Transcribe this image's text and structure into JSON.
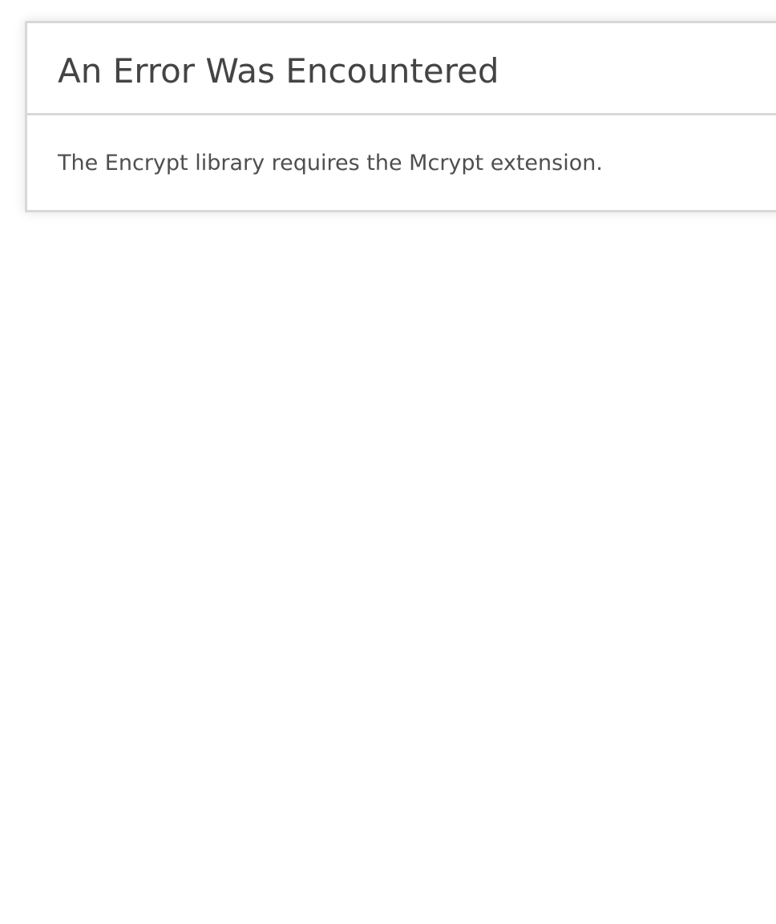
{
  "error": {
    "title": "An Error Was Encountered",
    "message": "The Encrypt library requires the Mcrypt extension."
  },
  "colors": {
    "background": "#ffffff",
    "border": "#d8d8d8",
    "title_text": "#444444",
    "message_text": "#4f4f4f"
  }
}
